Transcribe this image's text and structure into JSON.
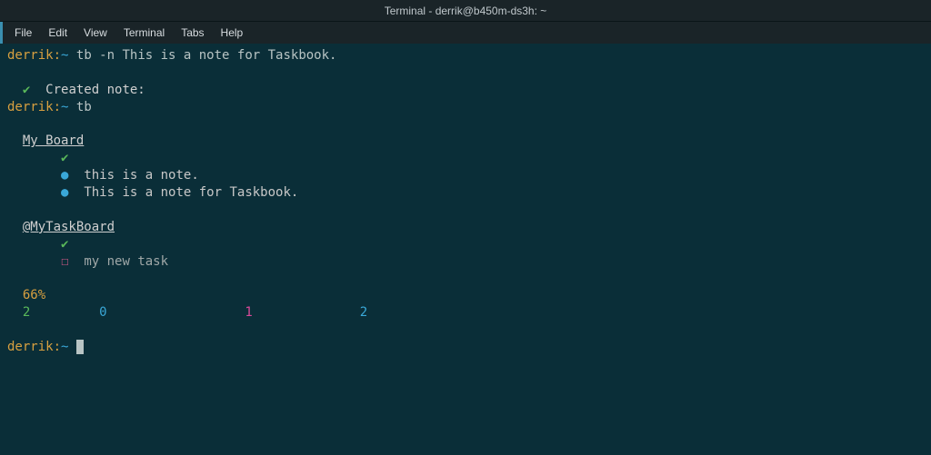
{
  "window": {
    "title": "Terminal - derrik@b450m-ds3h: ~"
  },
  "menu": {
    "file": "File",
    "edit": "Edit",
    "view": "View",
    "terminal": "Terminal",
    "tabs": "Tabs",
    "help": "Help"
  },
  "prompt": {
    "user": "derrik:",
    "path": "~"
  },
  "commands": {
    "cmd1": "tb -n This is a note for Taskbook.",
    "cmd2": "tb"
  },
  "output": {
    "check": "✔",
    "created_label": "Created note:",
    "board1_title": "My Board",
    "note1": "this is a note.",
    "note2": "This is a note for Taskbook.",
    "board2_title": "@MyTaskBoard",
    "checkbox": "☐",
    "task1": "my new task",
    "percent": "66%",
    "stat1": "2",
    "stat2": "0",
    "stat3": "1",
    "stat4": "2",
    "bullet": "●"
  }
}
